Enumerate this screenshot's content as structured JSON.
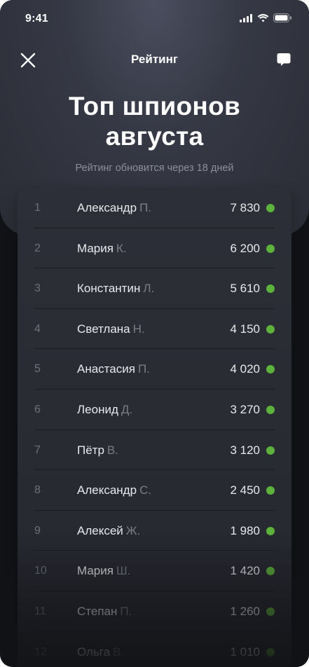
{
  "status": {
    "time": "9:41"
  },
  "nav": {
    "title": "Рейтинг"
  },
  "hero": {
    "title_line1": "Топ шпионов",
    "title_line2": "августа",
    "subtitle": "Рейтинг обновится через 18 дней"
  },
  "colors": {
    "points_dot": "#5cb23a",
    "background": "#111215",
    "card": "#2b2d35"
  },
  "ranking": [
    {
      "rank": "1",
      "name": "Александр",
      "initial": "П.",
      "score": "7 830"
    },
    {
      "rank": "2",
      "name": "Мария",
      "initial": "К.",
      "score": "6 200"
    },
    {
      "rank": "3",
      "name": "Константин",
      "initial": "Л.",
      "score": "5 610"
    },
    {
      "rank": "4",
      "name": "Светлана",
      "initial": "Н.",
      "score": "4 150"
    },
    {
      "rank": "5",
      "name": "Анастасия",
      "initial": "П.",
      "score": "4 020"
    },
    {
      "rank": "6",
      "name": "Леонид",
      "initial": "Д.",
      "score": "3 270"
    },
    {
      "rank": "7",
      "name": "Пётр",
      "initial": "В.",
      "score": "3 120"
    },
    {
      "rank": "8",
      "name": "Александр",
      "initial": "С.",
      "score": "2 450"
    },
    {
      "rank": "9",
      "name": "Алексей",
      "initial": "Ж.",
      "score": "1 980"
    },
    {
      "rank": "10",
      "name": "Мария",
      "initial": "Ш.",
      "score": "1 420"
    },
    {
      "rank": "11",
      "name": "Степан",
      "initial": "П.",
      "score": "1 260"
    },
    {
      "rank": "12",
      "name": "Ольга",
      "initial": "В.",
      "score": "1 010"
    }
  ]
}
